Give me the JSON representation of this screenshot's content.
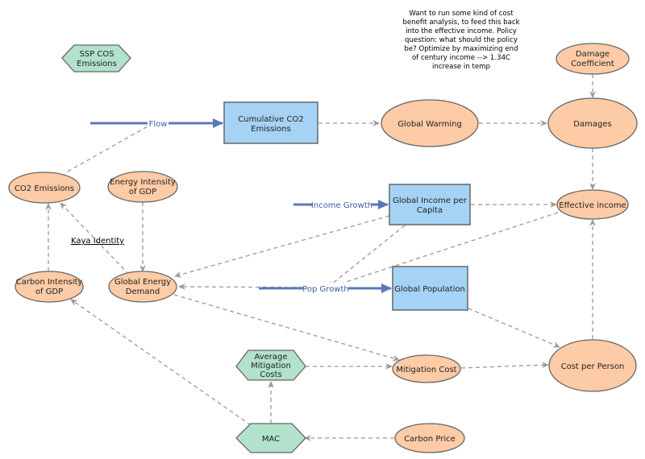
{
  "note": {
    "lines": [
      "Want to run some kind of cost",
      "benefit analysis, to feed this back",
      "into the effective income. Policy",
      "question: what should the policy",
      "be?  Optimize by maximizing end",
      "of century income --> 1.34C",
      "increase in temp"
    ]
  },
  "annotation": {
    "kaya": "Kaya Identity"
  },
  "colors": {
    "stock_fill": "#a6d3f5",
    "variable_fill": "#fdcba6",
    "converter_fill": "#b2e2cb",
    "flow": "#5b78b8",
    "link": "#999999"
  },
  "stocks": {
    "cumulative_co2": [
      "Cumulative CO2",
      "Emissions"
    ],
    "global_income": [
      "Global Income per",
      "Capita"
    ],
    "global_population": [
      "Global Population"
    ]
  },
  "variables": {
    "global_warming": [
      "Global Warming"
    ],
    "damages": [
      "Damages"
    ],
    "damage_coefficient": [
      "Damage",
      "Coefficient"
    ],
    "effective_income": [
      "Effective income"
    ],
    "co2_emissions": [
      "CO2 Emissions"
    ],
    "energy_intensity": [
      "Energy Intensity",
      "of GDP"
    ],
    "carbon_intensity": [
      "Carbon Intensity",
      "of GDP"
    ],
    "global_energy_demand": [
      "Global Energy",
      "Demand"
    ],
    "mitigation_cost": [
      "Mitigation Cost"
    ],
    "cost_per_person": [
      "Cost per Person"
    ],
    "carbon_price": [
      "Carbon Price"
    ]
  },
  "converters": {
    "ssp_cos": [
      "SSP COS",
      "Emissions"
    ],
    "avg_mitigation": [
      "Average",
      "Mitigation",
      "Costs"
    ],
    "mac": [
      "MAC"
    ]
  },
  "flows": {
    "flow": "Flow",
    "income_growth": "Income Growth",
    "pop_growth": "Pop Growth"
  }
}
